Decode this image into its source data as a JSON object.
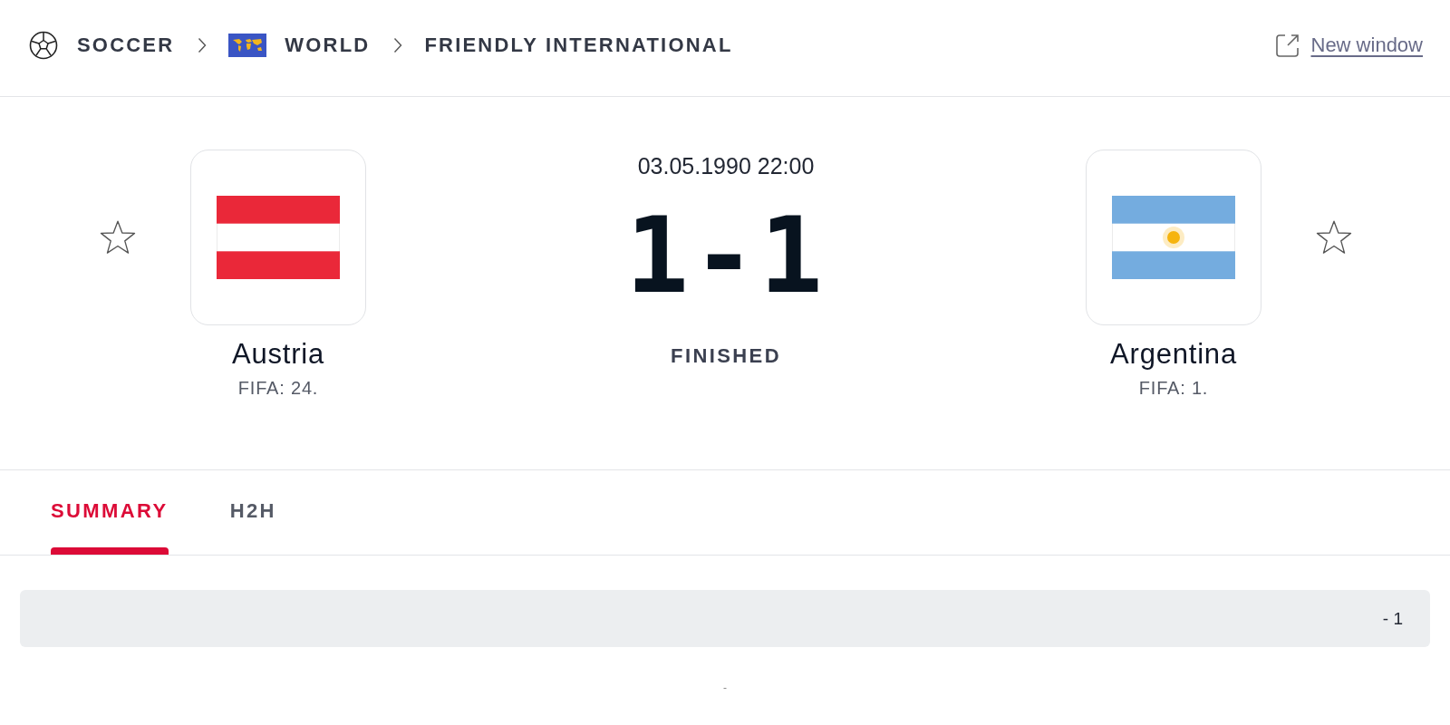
{
  "breadcrumb": [
    {
      "label": "SOCCER",
      "kind": "sport"
    },
    {
      "label": "WORLD",
      "kind": "region"
    },
    {
      "label": "FRIENDLY INTERNATIONAL",
      "kind": "competition"
    }
  ],
  "new_window_link": "New window",
  "match": {
    "date": "03.05.1990 22:00",
    "score": "1-1",
    "status": "FINISHED",
    "home": {
      "name": "Austria",
      "rank": "FIFA: 24.",
      "favorite": false
    },
    "away": {
      "name": "Argentina",
      "rank": "FIFA: 1.",
      "favorite": false
    }
  },
  "tabs": [
    {
      "label": "SUMMARY",
      "selected": true
    },
    {
      "label": "H2H",
      "selected": false
    }
  ],
  "summary_row": {
    "score": "- 1"
  },
  "footer_mark": "-"
}
